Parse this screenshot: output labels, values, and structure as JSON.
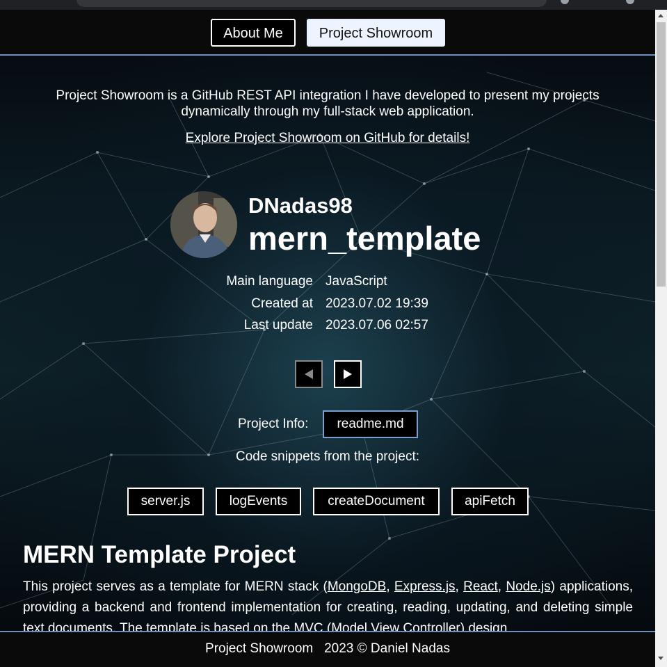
{
  "nav": {
    "about_label": "About Me",
    "showroom_label": "Project Showroom"
  },
  "intro": {
    "text": "Project Showroom is a GitHub REST API integration I have developed to present my projects dynamically through my full-stack web application.",
    "link_text": "Explore Project Showroom on GitHub for details!"
  },
  "repo": {
    "owner": "DNadas98",
    "name": "mern_template",
    "meta": [
      {
        "label": "Main language",
        "value": "JavaScript"
      },
      {
        "label": "Created at",
        "value": "2023.07.02 19:39"
      },
      {
        "label": "Last update",
        "value": "2023.07.06 02:57"
      }
    ]
  },
  "project_info": {
    "label": "Project Info:",
    "readme_label": "readme.md",
    "snippets_label": "Code snippets from the project:",
    "snippets": [
      "server.js",
      "logEvents",
      "createDocument",
      "apiFetch"
    ]
  },
  "readme": {
    "title": "MERN Template Project",
    "body_start": "This project serves as a template for MERN stack (",
    "links": [
      "MongoDB",
      "Express.js",
      "React",
      "Node.js"
    ],
    "body_end": ") applications, providing a backend and frontend implementation for creating, reading, updating, and deleting simple text documents. The template is based on the MVC (Model View Controller) design"
  },
  "footer": {
    "text": "Project Showroom   2023 © Daniel Nadas"
  }
}
